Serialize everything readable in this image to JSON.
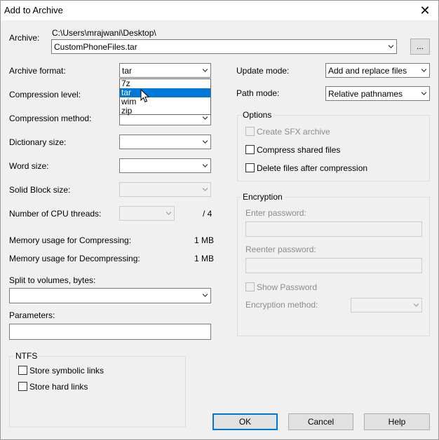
{
  "window": {
    "title": "Add to Archive"
  },
  "archive": {
    "label": "Archive:",
    "path": "C:\\Users\\mrajwani\\Desktop\\",
    "filename": "CustomPhoneFiles.tar",
    "browse_label": "..."
  },
  "left": {
    "archive_format": {
      "label": "Archive format:",
      "value": "tar",
      "options": [
        "7z",
        "tar",
        "wim",
        "zip"
      ],
      "selected": "tar"
    },
    "compression_level": {
      "label": "Compression level:"
    },
    "compression_method": {
      "label": "Compression method:"
    },
    "dictionary_size": {
      "label": "Dictionary size:"
    },
    "word_size": {
      "label": "Word size:"
    },
    "solid_block_size": {
      "label": "Solid Block size:"
    },
    "cpu_threads": {
      "label": "Number of CPU threads:",
      "max": "/ 4"
    },
    "mem_compress": {
      "label": "Memory usage for Compressing:",
      "value": "1 MB"
    },
    "mem_decompress": {
      "label": "Memory usage for Decompressing:",
      "value": "1 MB"
    },
    "split": {
      "label": "Split to volumes, bytes:",
      "value": ""
    },
    "parameters": {
      "label": "Parameters:",
      "value": ""
    },
    "ntfs": {
      "title": "NTFS",
      "symbolic_links": "Store symbolic links",
      "hard_links": "Store hard links"
    }
  },
  "right": {
    "update_mode": {
      "label": "Update mode:",
      "value": "Add and replace files"
    },
    "path_mode": {
      "label": "Path mode:",
      "value": "Relative pathnames"
    },
    "options": {
      "title": "Options",
      "sfx": "Create SFX archive",
      "shared": "Compress shared files",
      "delete": "Delete files after compression"
    },
    "encryption": {
      "title": "Encryption",
      "enter_password": "Enter password:",
      "reenter_password": "Reenter password:",
      "show_password": "Show Password",
      "method": "Encryption method:"
    }
  },
  "buttons": {
    "ok": "OK",
    "cancel": "Cancel",
    "help": "Help"
  },
  "colors": {
    "accent": "#0078d7",
    "background": "#f0f0f0"
  }
}
